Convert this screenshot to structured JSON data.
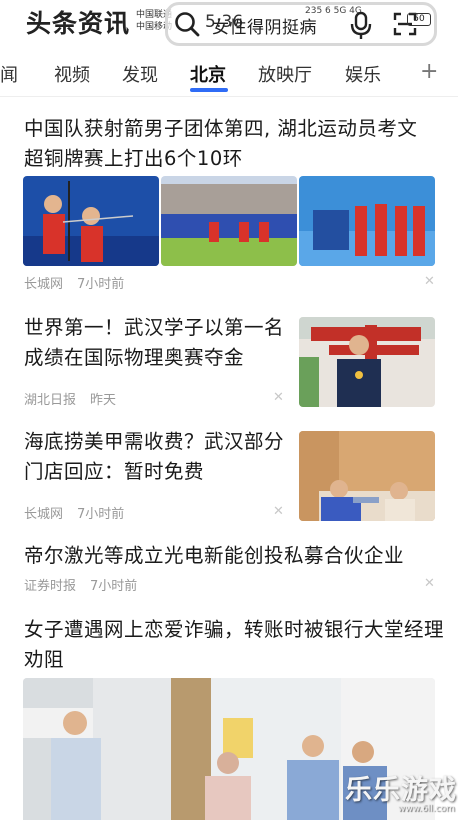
{
  "app": {
    "logo": "头条资讯",
    "carriers": [
      "中国联通",
      "中国移动"
    ],
    "clock": "5:36",
    "search_text": "女性得阴挺病",
    "status_text": "235 6 5G 4G",
    "battery": "50"
  },
  "tabs": [
    {
      "label": "新闻",
      "display": "闻"
    },
    {
      "label": "视频",
      "display": "视频"
    },
    {
      "label": "发现",
      "display": "发现"
    },
    {
      "label": "北京",
      "display": "北京",
      "active": true
    },
    {
      "label": "放映厅",
      "display": "放映厅"
    },
    {
      "label": "娱乐",
      "display": "娱乐"
    },
    {
      "label": "+",
      "display": "+"
    }
  ],
  "articles": [
    {
      "title": "中国队获射箭男子团体第四, 湖北运动员考文超铜牌赛上打出6个10环",
      "source": "长城网",
      "time": "7小时前",
      "images": [
        "archers-aiming",
        "archery-range-panorama",
        "team-on-field"
      ]
    },
    {
      "title": "世界第一！武汉学子以第一名成绩在国际物理奥赛夺金",
      "source": "湖北日报",
      "time": "昨天",
      "images": [
        "student-with-medal"
      ]
    },
    {
      "title": "海底捞美甲需收费？武汉部分门店回应：暂时免费",
      "source": "长城网",
      "time": "7小时前",
      "images": [
        "nail-salon-scene"
      ]
    },
    {
      "title": "帝尔激光等成立光电新能创投私募合伙企业",
      "source": "证券时报",
      "time": "7小时前",
      "images": []
    },
    {
      "title": "女子遭遇网上恋爱诈骗，转账时被银行大堂经理劝阻",
      "source": "",
      "time": "",
      "images": [
        "bank-lobby-scene"
      ]
    }
  ],
  "watermark": {
    "main": "乐乐游戏",
    "sub": "www.6ll.com"
  },
  "icons": [
    "search-icon",
    "mic-icon",
    "scan-icon",
    "close-icon",
    "plus-icon"
  ]
}
